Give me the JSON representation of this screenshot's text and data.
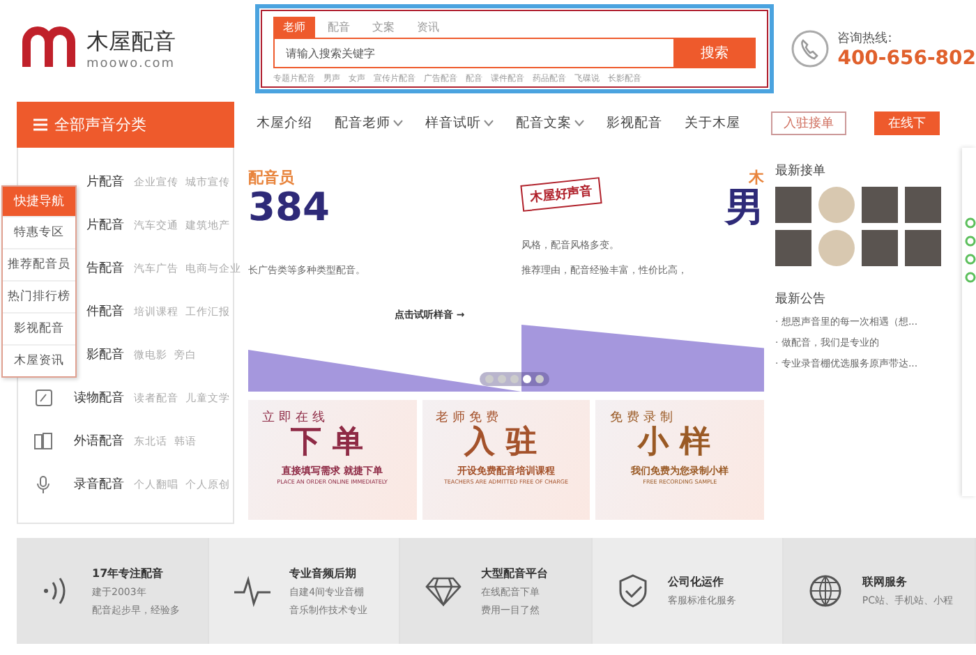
{
  "logo": {
    "name": "木屋配音",
    "domain": "moowo.com"
  },
  "search": {
    "tabs": [
      {
        "label": "老师",
        "selected": true
      },
      {
        "label": "配音",
        "selected": false
      },
      {
        "label": "文案",
        "selected": false
      },
      {
        "label": "资讯",
        "selected": false
      }
    ],
    "placeholder": "请输入搜索关键字",
    "button": "搜索",
    "hot_words": [
      "专题片配音",
      "男声",
      "女声",
      "宣传片配音",
      "广告配音",
      "配音",
      "课件配音",
      "药品配音",
      "飞碟说",
      "长影配音"
    ]
  },
  "hotline": {
    "label": "咨询热线:",
    "number": "400-656-802"
  },
  "category_header": "全部声音分类",
  "nav": [
    {
      "label": "木屋介绍",
      "dropdown": false
    },
    {
      "label": "配音老师",
      "dropdown": true
    },
    {
      "label": "样音试听",
      "dropdown": true
    },
    {
      "label": "配音文案",
      "dropdown": true
    },
    {
      "label": "影视配音",
      "dropdown": false
    },
    {
      "label": "关于木屋",
      "dropdown": false
    }
  ],
  "header_buttons": [
    {
      "label": "入驻接单",
      "kind": "outline"
    },
    {
      "label": "在线下",
      "kind": "solid"
    }
  ],
  "categories": [
    {
      "kind": "covered",
      "name": "片配音",
      "tags": [
        "企业宣传",
        "城市宣传"
      ]
    },
    {
      "kind": "covered",
      "name": "片配音",
      "tags": [
        "汽车交通",
        "建筑地产"
      ]
    },
    {
      "kind": "covered",
      "name": "告配音",
      "tags": [
        "汽车广告",
        "电商与企业"
      ]
    },
    {
      "kind": "covered",
      "name": "件配音",
      "tags": [
        "培训课程",
        "工作汇报"
      ]
    },
    {
      "kind": "covered",
      "name": "影配音",
      "tags": [
        "微电影",
        "旁白"
      ]
    },
    {
      "kind": "book",
      "name": "读物配音",
      "tags": [
        "读者配音",
        "儿童文学"
      ]
    },
    {
      "kind": "language",
      "name": "外语配音",
      "tags": [
        "东北话",
        "韩语"
      ]
    },
    {
      "kind": "mic",
      "name": "录音配音",
      "tags": [
        "个人翻唱",
        "个人原创"
      ]
    }
  ],
  "quick_nav": {
    "title": "快捷导航",
    "items": [
      "特惠专区",
      "推荐配音员",
      "热门排行榜",
      "影视配音",
      "木屋资讯"
    ]
  },
  "banner": {
    "left_kicker": "配音员",
    "left_number": "384",
    "left_text": "长广告类等多种类型配音。",
    "left_link": "点击试听样音 →",
    "stamp": "木屋好声音",
    "right_kicker": "木",
    "right_title": "男",
    "right_lines": [
      "风格，配音风格多变。",
      "推荐理由，配音经验丰富，性价比高，"
    ],
    "dots": [
      {
        "selected": false
      },
      {
        "selected": false
      },
      {
        "selected": false
      },
      {
        "selected": true
      },
      {
        "selected": false
      }
    ]
  },
  "latest_orders": {
    "title": "最新接单",
    "avatars": [
      {
        "kind": "photo"
      },
      {
        "kind": "cartoon"
      },
      {
        "kind": "photo"
      },
      {
        "kind": "photo"
      },
      {
        "kind": "photo"
      },
      {
        "kind": "cartoon"
      },
      {
        "kind": "photo"
      },
      {
        "kind": "photo"
      }
    ]
  },
  "notices": {
    "title": "最新公告",
    "items": [
      "· 想恩声音里的每一次相遇（想...",
      "· 做配音，我们是专业的",
      "· 专业录音棚优选服务原声带达..."
    ]
  },
  "promos": [
    {
      "kicker": "立即在线",
      "title": "下单",
      "subtitle": "直接填写需求 就捷下单",
      "english": "PLACE AN ORDER ONLINE IMMEDIATELY",
      "color": "#8e2a45"
    },
    {
      "kicker": "老师免费",
      "title": "入驻",
      "subtitle": "开设免费配音培训课程",
      "english": "TEACHERS ARE ADMITTED FREE OF CHARGE",
      "color": "#a4522b"
    },
    {
      "kicker": "免费录制",
      "title": "小样",
      "subtitle": "我们免费为您录制小样",
      "english": "FREE RECORDING SAMPLE",
      "color": "#9a5a25"
    }
  ],
  "features": [
    {
      "kind": "signal",
      "title": "17年专注配音",
      "lines": [
        "建于2003年",
        "配音起步早，经验多"
      ]
    },
    {
      "kind": "pulse",
      "title": "专业音频后期",
      "lines": [
        "自建4间专业音棚",
        "音乐制作技术专业"
      ]
    },
    {
      "kind": "diamond",
      "title": "大型配音平台",
      "lines": [
        "在线配音下单",
        "费用一目了然"
      ]
    },
    {
      "kind": "shield",
      "title": "公司化运作",
      "lines": [
        "客服标准化服务"
      ]
    },
    {
      "kind": "globe",
      "title": "联网服务",
      "lines": [
        "PC站、手机站、小程"
      ]
    }
  ]
}
